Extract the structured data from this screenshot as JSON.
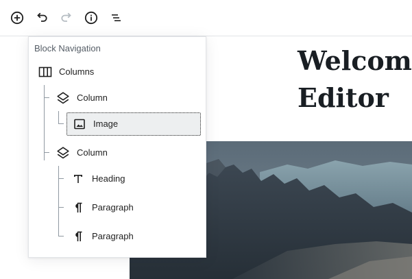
{
  "toolbar": {
    "buttons": [
      {
        "name": "add-block-button",
        "icon": "plus-circle-icon",
        "enabled": true
      },
      {
        "name": "undo-button",
        "icon": "undo-icon",
        "enabled": true
      },
      {
        "name": "redo-button",
        "icon": "redo-icon",
        "enabled": false
      },
      {
        "name": "content-info-button",
        "icon": "info-icon",
        "enabled": true
      },
      {
        "name": "block-navigation-button",
        "icon": "list-icon",
        "enabled": true
      }
    ]
  },
  "block_navigation": {
    "title": "Block Navigation",
    "items": [
      {
        "label": "Columns",
        "icon": "columns-icon",
        "depth": 0
      },
      {
        "label": "Column",
        "icon": "column-layers-icon",
        "depth": 1
      },
      {
        "label": "Image",
        "icon": "image-icon",
        "depth": 2,
        "selected": true
      },
      {
        "label": "Column",
        "icon": "column-layers-icon",
        "depth": 1
      },
      {
        "label": "Heading",
        "icon": "heading-icon",
        "depth": 2
      },
      {
        "label": "Paragraph",
        "icon": "paragraph-icon",
        "depth": 2
      },
      {
        "label": "Paragraph",
        "icon": "paragraph-icon",
        "depth": 2
      }
    ]
  },
  "editor": {
    "heading": "Welcome\nEditor"
  },
  "colors": {
    "icon": "#1e1e1e",
    "icon_disabled": "#b5bcc2",
    "selected_background": "#edeff0",
    "tree_line": "#8f98a1"
  }
}
